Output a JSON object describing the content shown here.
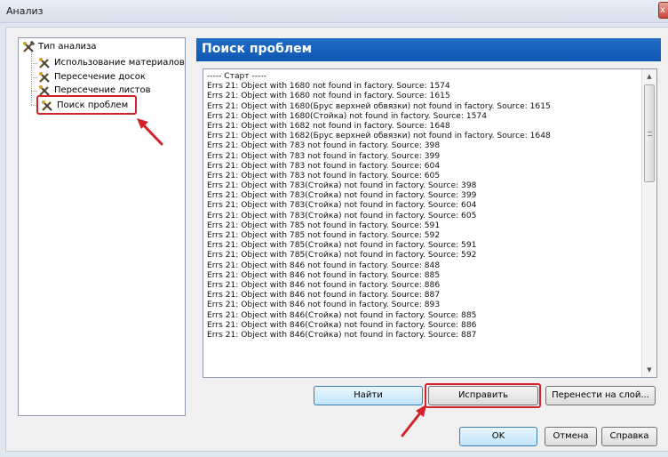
{
  "window": {
    "title": "Анализ",
    "close_label": "x"
  },
  "tree": {
    "root_label": "Тип анализа",
    "items": [
      {
        "label": "Использование материалов"
      },
      {
        "label": "Пересечение досок"
      },
      {
        "label": "Пересечение листов"
      },
      {
        "label": "Поиск проблем"
      }
    ]
  },
  "panel": {
    "title": "Поиск проблем"
  },
  "log": {
    "lines": [
      "----- Старт -----",
      "Errs 21: Object with 1680 not found in factory. Source: 1574",
      "Errs 21: Object with 1680 not found in factory. Source: 1615",
      "Errs 21: Object with 1680(Брус верхней обвязки) not found in factory. Source: 1615",
      "Errs 21: Object with 1680(Стойка) not found in factory. Source: 1574",
      "Errs 21: Object with 1682 not found in factory. Source: 1648",
      "Errs 21: Object with 1682(Брус верхней обвязки) not found in factory. Source: 1648",
      "Errs 21: Object with 783 not found in factory. Source: 398",
      "Errs 21: Object with 783 not found in factory. Source: 399",
      "Errs 21: Object with 783 not found in factory. Source: 604",
      "Errs 21: Object with 783 not found in factory. Source: 605",
      "Errs 21: Object with 783(Стойка) not found in factory. Source: 398",
      "Errs 21: Object with 783(Стойка) not found in factory. Source: 399",
      "Errs 21: Object with 783(Стойка) not found in factory. Source: 604",
      "Errs 21: Object with 783(Стойка) not found in factory. Source: 605",
      "Errs 21: Object with 785 not found in factory. Source: 591",
      "Errs 21: Object with 785 not found in factory. Source: 592",
      "Errs 21: Object with 785(Стойка) not found in factory. Source: 591",
      "Errs 21: Object with 785(Стойка) not found in factory. Source: 592",
      "Errs 21: Object with 846 not found in factory. Source: 848",
      "Errs 21: Object with 846 not found in factory. Source: 885",
      "Errs 21: Object with 846 not found in factory. Source: 886",
      "Errs 21: Object with 846 not found in factory. Source: 887",
      "Errs 21: Object with 846 not found in factory. Source: 893",
      "Errs 21: Object with 846(Стойка) not found in factory. Source: 885",
      "Errs 21: Object with 846(Стойка) not found in factory. Source: 886",
      "Errs 21: Object with 846(Стойка) not found in factory. Source: 887"
    ]
  },
  "buttons": {
    "find": "Найти",
    "fix": "Исправить",
    "move_to_layer": "Перенести на слой...",
    "ok": "OK",
    "cancel": "Отмена",
    "help": "Справка"
  },
  "colors": {
    "header": "#1565c0",
    "highlight": "#d4222a"
  }
}
